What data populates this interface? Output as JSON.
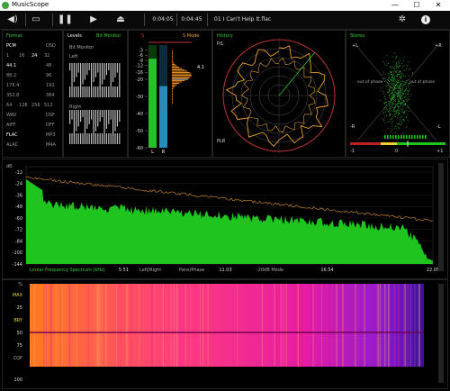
{
  "window": {
    "title": "MusicScope",
    "minimize": "—",
    "maximize": "☐",
    "close": "✕"
  },
  "toolbar": {
    "volume_icon": "speaker-icon",
    "open_icon": "folder-icon",
    "pause_icon": "pause-icon",
    "play_icon": "play-icon",
    "eject_icon": "eject-icon",
    "time_elapsed": "0:04:05",
    "time_total": "0:04:45",
    "track": "01 I Can't Help It.flac",
    "settings_icon": "gear-icon",
    "info_icon": "info-icon"
  },
  "format": {
    "title": "Format",
    "rows": [
      [
        "PCM",
        "",
        "DSD"
      ],
      [
        "1",
        "16",
        "24",
        "32"
      ],
      [
        "44.1",
        "",
        "48"
      ],
      [
        "88.2",
        "",
        "96"
      ],
      [
        "176.4",
        "",
        "192"
      ],
      [
        "352.8",
        "",
        "384"
      ],
      [
        "64",
        "128",
        "256",
        "512"
      ],
      [
        "WAV",
        "",
        "DSF"
      ],
      [
        "AIFF",
        "",
        "DFF"
      ],
      [
        "FLAC",
        "",
        "MP3"
      ],
      [
        "ALAC",
        "",
        "M4A"
      ]
    ]
  },
  "levels": {
    "title": "Levels",
    "mode": "Bit Monitor",
    "subtitle": "Bit Monitor",
    "left": "Left",
    "right": "Right",
    "scale": [
      "-3",
      "-6",
      "-9",
      "-12",
      "-16",
      "-20",
      "-30",
      "-40",
      "-50",
      "-60"
    ],
    "peak_label": "4.1",
    "left_level_db": -8,
    "right_level_db": -24,
    "s_label": "S",
    "s_mode": "S Mode",
    "lr": [
      "L",
      "R"
    ]
  },
  "history": {
    "title": "History",
    "top_label": "P/L",
    "bottom_label": "PLR"
  },
  "stereo": {
    "title": "Stereo",
    "plus_l": "+L",
    "plus_r": "+R",
    "minus_l": "-R",
    "minus_r": "-L",
    "out_phase_left": "out of phase",
    "out_phase_right": "out of phase",
    "corr_min": "-1",
    "corr_zero": "0",
    "corr_max": "+1"
  },
  "spectrum": {
    "db_label": "dB",
    "y_ticks": [
      "-12",
      "-24",
      "-36",
      "-48",
      "-60",
      "-72",
      "-84",
      "-100",
      "-144"
    ],
    "mode": "Linear Frequency Spectrum (kHz)",
    "x_ticks": [
      "5.51",
      "11.03",
      "16.54",
      "22.05"
    ],
    "options": [
      "Left/Right",
      "Pans/Phase",
      "-20dB Mode"
    ]
  },
  "spectrogram": {
    "y_ticks": [
      "%",
      "MAX",
      "25",
      "BRY",
      "50",
      "75",
      "CQF",
      "100"
    ]
  }
}
